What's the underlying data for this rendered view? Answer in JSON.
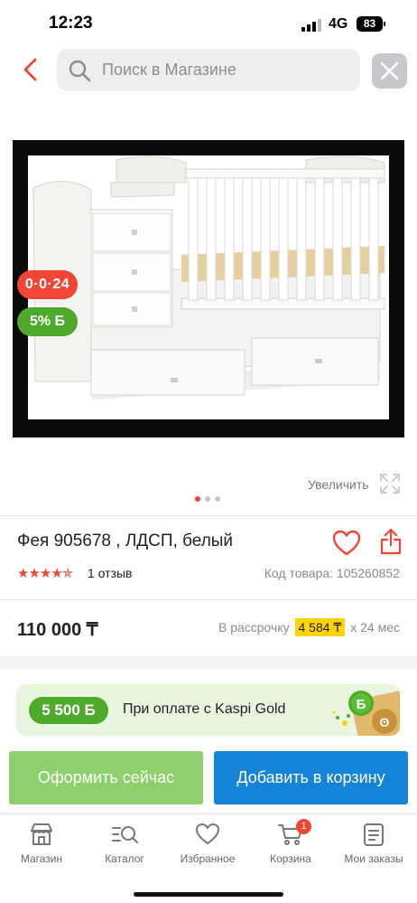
{
  "status_bar": {
    "time": "12:23",
    "network": "4G",
    "battery": "83"
  },
  "header": {
    "search_placeholder": "Поиск в Магазине"
  },
  "gallery": {
    "badges": {
      "sale": "0·0·24",
      "bonus": "5% Б"
    },
    "zoom_label": "Увеличить",
    "dots_total": 3,
    "dots_active": 1
  },
  "product": {
    "title": "Фея 905678 , ЛДСП, белый",
    "rating": 4.5,
    "stars": "★★★★✯",
    "reviews": "1 отзыв",
    "code": "Код товара: 105260852",
    "price": "110 000 ₸",
    "installment_prefix": "В рассрочку",
    "installment_amount": "4 584 ₸",
    "installment_suffix": "x 24 мес"
  },
  "kaspi_gold": {
    "bonus": "5 500 Б",
    "text": "При оплате с Kaspi Gold"
  },
  "actions": {
    "buy_now": "Оформить сейчас",
    "add_to_cart": "Добавить в корзину"
  },
  "tabs": [
    {
      "label": "Магазин",
      "icon": "shop-icon"
    },
    {
      "label": "Каталог",
      "icon": "catalog-icon"
    },
    {
      "label": "Избранное",
      "icon": "heart-icon"
    },
    {
      "label": "Корзина",
      "icon": "cart-icon",
      "badge": "1"
    },
    {
      "label": "Мои заказы",
      "icon": "orders-icon"
    }
  ],
  "colors": {
    "accent_red": "#f14635",
    "bonus_green": "#4fa92a",
    "buy_green": "#8ed06b",
    "cart_blue": "#1584d6",
    "installment_yellow": "#ffd400"
  }
}
